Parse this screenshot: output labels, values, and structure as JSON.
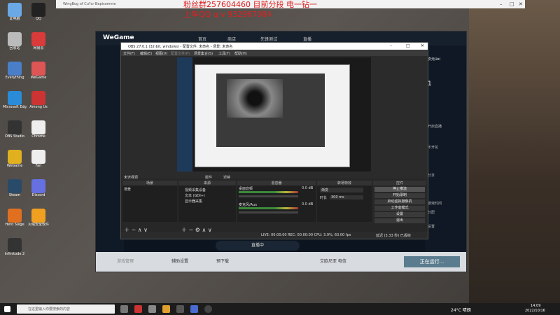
{
  "overlay": {
    "line1": "粉丝群257604460 目前分段 电一钻一",
    "line2": "上车QQ q v 932967084"
  },
  "outer_window": {
    "title": "WingBog of Cu?cr Bepisomme",
    "min": "–",
    "restore": "□",
    "close": "✕"
  },
  "desktop_icons": [
    {
      "label": "此电脑",
      "color": "#6aa8e6"
    },
    {
      "label": "QQ",
      "color": "#222"
    },
    {
      "label": "回收站",
      "color": "#bbb"
    },
    {
      "label": "网易云",
      "color": "#d93a3a"
    },
    {
      "label": "Everything",
      "color": "#4a7ec9"
    },
    {
      "label": "WeGame",
      "color": "#d55"
    },
    {
      "label": "Microsoft Edge",
      "color": "#2a8bd8"
    },
    {
      "label": "Among Us",
      "color": "#c33"
    },
    {
      "label": "OBS Studio",
      "color": "#333"
    },
    {
      "label": "Chrome",
      "color": "#eee"
    },
    {
      "label": "WeGame",
      "color": "#e0b020"
    },
    {
      "label": "Fan",
      "color": "#eee"
    },
    {
      "label": "Steam",
      "color": "#2a4a6a"
    },
    {
      "label": "Discord",
      "color": "#6670e0"
    },
    {
      "label": "Hero Siege",
      "color": "#e07020"
    },
    {
      "label": "火绒安全软件",
      "color": "#f0a020"
    },
    {
      "label": "Infinitode 2",
      "color": "#333"
    }
  ],
  "wegame": {
    "logo": "WeGame",
    "nav": [
      "首页",
      "商店",
      "先锋测试",
      "直播"
    ],
    "right_panel": [
      "次元Uxi",
      "1",
      "开启直播",
      "不开花",
      "分享",
      "游戏时间",
      "分配",
      "设置"
    ],
    "bottom": {
      "left": "游戏管理",
      "help": "辅助设置",
      "download": "预下载",
      "notice": "艾欧尼亚 电信",
      "status": "正在运行..."
    }
  },
  "obs": {
    "title": "OBS 27.0.1 (32-bit, windows) - 配置文件: 未命名 - 场景: 未命名",
    "menu": [
      "文件(F)",
      "编辑(E)",
      "视图(V)",
      "配置文件(P)",
      "场景集合(S)",
      "工具(T)",
      "帮助(H)"
    ],
    "no_source": "未选择源",
    "props": "属性",
    "filters": "滤镜",
    "docks": {
      "scenes": "场景",
      "sources": "来源",
      "mixer": "混音器",
      "transitions": "转场特效",
      "controls": "控件"
    },
    "scene_items": [
      "场景"
    ],
    "source_items": [
      "视频采集设备",
      "文本 (GDI+)",
      "显示器采集"
    ],
    "mixer": {
      "track1": "桌面音频",
      "track2": "麦克风/Aux",
      "db1": "0.0 dB",
      "db2": "0.0 dB"
    },
    "transition": {
      "type": "渐变",
      "duration_label": "时长",
      "duration_value": "300 ms"
    },
    "controls": [
      "停止推流",
      "开始录制",
      "启动虚拟摄像机",
      "工作室模式",
      "设置",
      "退出"
    ],
    "status": "LIVE: 00:00:00  REC: 00:00:00  CPU: 3.9%, 60.00 fps",
    "status_right": "延迟 (3.33 秒) 已丢帧"
  },
  "under": {
    "live_btn": "直播中"
  },
  "taskbar": {
    "search": "在这里输入你要搜索的内容",
    "weather": "24°C 晴朗",
    "time": "14:09",
    "date": "2022/10/16"
  }
}
